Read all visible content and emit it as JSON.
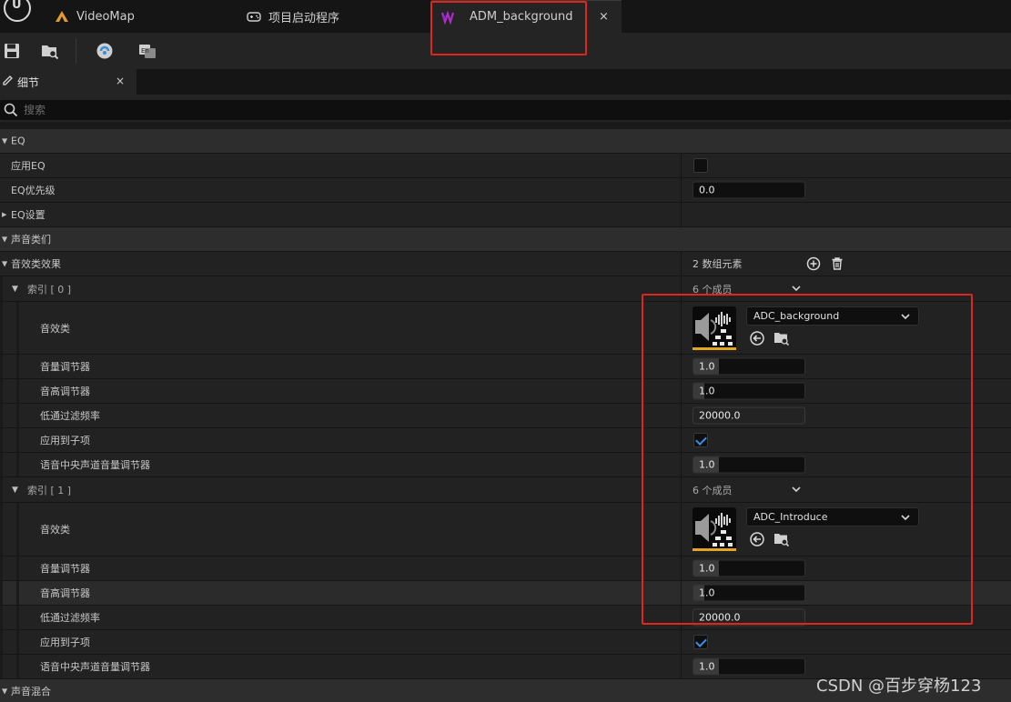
{
  "tabs": {
    "videomap": "VideoMap",
    "launcher": "项目启动程序",
    "active": "ADM_background",
    "close": "×"
  },
  "details_panel": {
    "title": "细节",
    "close": "×"
  },
  "search": {
    "placeholder": "搜索"
  },
  "eq": {
    "category": "EQ",
    "apply_eq_label": "应用EQ",
    "apply_eq_checked": false,
    "priority_label": "EQ优先级",
    "priority_value": "0.0",
    "settings_label": "EQ设置"
  },
  "sound_classes": {
    "category": "声音类们",
    "effects_label": "音效类效果",
    "effects_count": "2 数组元素",
    "items": [
      {
        "index_label": "索引 [ 0 ]",
        "members": "6 个成员",
        "sound_class_label": "音效类",
        "sound_class_value": "ADC_background",
        "volume_label": "音量调节器",
        "volume_value": "1.0",
        "pitch_label": "音高调节器",
        "pitch_value": "1.0",
        "lowpass_label": "低通过滤频率",
        "lowpass_value": "20000.0",
        "apply_children_label": "应用到子项",
        "apply_children_checked": true,
        "center_label": "语音中央声道音量调节器",
        "center_value": "1.0"
      },
      {
        "index_label": "索引 [ 1 ]",
        "members": "6 个成员",
        "sound_class_label": "音效类",
        "sound_class_value": "ADC_Introduce",
        "volume_label": "音量调节器",
        "volume_value": "1.0",
        "pitch_label": "音高调节器",
        "pitch_value": "1.0",
        "lowpass_label": "低通过滤频率",
        "lowpass_value": "20000.0",
        "apply_children_label": "应用到子项",
        "apply_children_checked": true,
        "center_label": "语音中央声道音量调节器",
        "center_value": "1.0"
      }
    ]
  },
  "sound_mix": {
    "category": "声音混合"
  },
  "watermark": "CSDN @百步穿杨123",
  "colors": {
    "highlight_box": "#e0251f",
    "checkbox_tick": "#3d8de8",
    "asset_bar": "#e6a520",
    "adm_icon": "#b02cc8"
  }
}
